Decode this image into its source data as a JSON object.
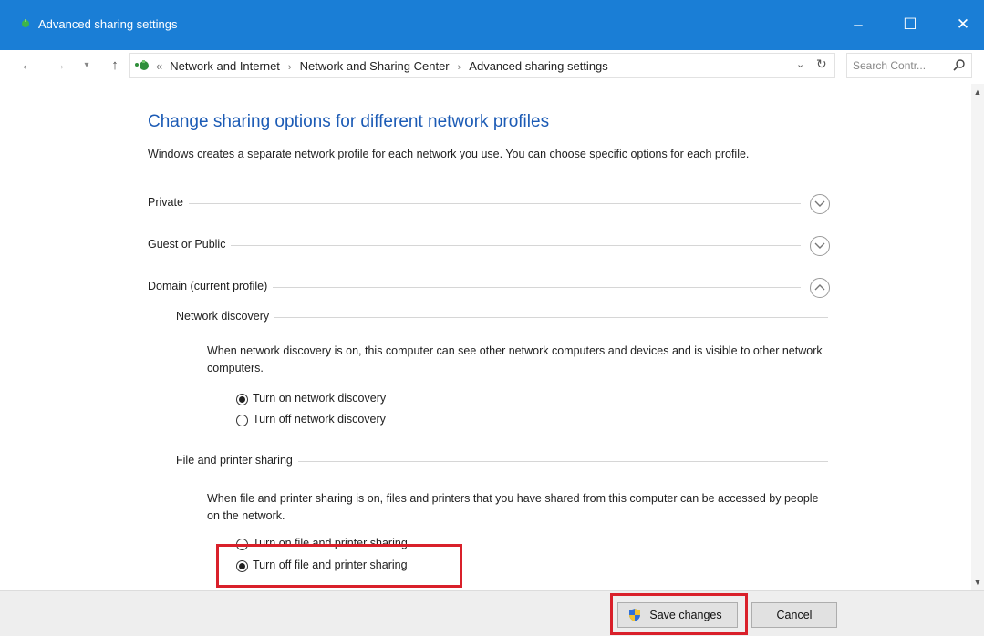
{
  "window": {
    "title": "Advanced sharing settings",
    "controls": {
      "minimize": "–",
      "maximize": "☐",
      "close": "✕"
    }
  },
  "address_bar": {
    "lead": "«",
    "breadcrumbs": [
      "Network and Internet",
      "Network and Sharing Center",
      "Advanced sharing settings"
    ],
    "separator": "›",
    "search_placeholder": "Search Contr..."
  },
  "main": {
    "heading": "Change sharing options for different network profiles",
    "description": "Windows creates a separate network profile for each network you use. You can choose specific options for each profile.",
    "profiles": [
      {
        "label": "Private",
        "expanded": false
      },
      {
        "label": "Guest or Public",
        "expanded": false
      },
      {
        "label": "Domain (current profile)",
        "expanded": true
      }
    ],
    "network_discovery": {
      "title": "Network discovery",
      "description": "When network discovery is on, this computer can see other network computers and devices and is visible to other network computers.",
      "options": [
        {
          "label": "Turn on network discovery",
          "checked": true
        },
        {
          "label": "Turn off network discovery",
          "checked": false
        }
      ]
    },
    "file_printer_sharing": {
      "title": "File and printer sharing",
      "description": "When file and printer sharing is on, files and printers that you have shared from this computer can be accessed by people on the network.",
      "options": [
        {
          "label": "Turn on file and printer sharing",
          "checked": false
        },
        {
          "label": "Turn off file and printer sharing",
          "checked": true
        }
      ]
    }
  },
  "footer": {
    "save_label": "Save changes",
    "cancel_label": "Cancel"
  },
  "colors": {
    "titlebar": "#1a7ed6",
    "heading": "#1c5bb5",
    "highlight": "#d9202a"
  }
}
